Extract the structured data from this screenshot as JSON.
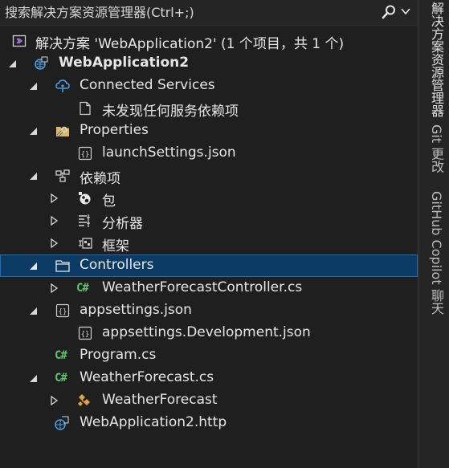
{
  "search": {
    "placeholder": "搜索解决方案资源管理器(Ctrl+;)"
  },
  "tree": {
    "solution": "解决方案 'WebApplication2' (1 个项目，共 1 个)",
    "project": "WebApplication2",
    "connected_services": "Connected Services",
    "no_dependencies": "未发现任何服务依赖项",
    "properties": "Properties",
    "launch_settings": "launchSettings.json",
    "dependencies": "依赖项",
    "packages": "包",
    "analyzers": "分析器",
    "frameworks": "框架",
    "controllers": "Controllers",
    "weather_controller": "WeatherForecastController.cs",
    "appsettings": "appsettings.json",
    "appsettings_dev": "appsettings.Development.json",
    "program": "Program.cs",
    "weather_forecast_cs": "WeatherForecast.cs",
    "weather_forecast_class": "WeatherForecast",
    "http_file": "WebApplication2.http",
    "csharp_icon_text": "C#"
  },
  "sidebar": {
    "tabs": [
      "解决方案资源管理器",
      "Git 更改",
      "GitHub Copilot 聊天"
    ]
  },
  "colors": {
    "selected_bg": "#0b3a63",
    "selected_border": "#1e6fb4",
    "csharp_green": "#5cc66b",
    "folder": "#dcb967"
  }
}
